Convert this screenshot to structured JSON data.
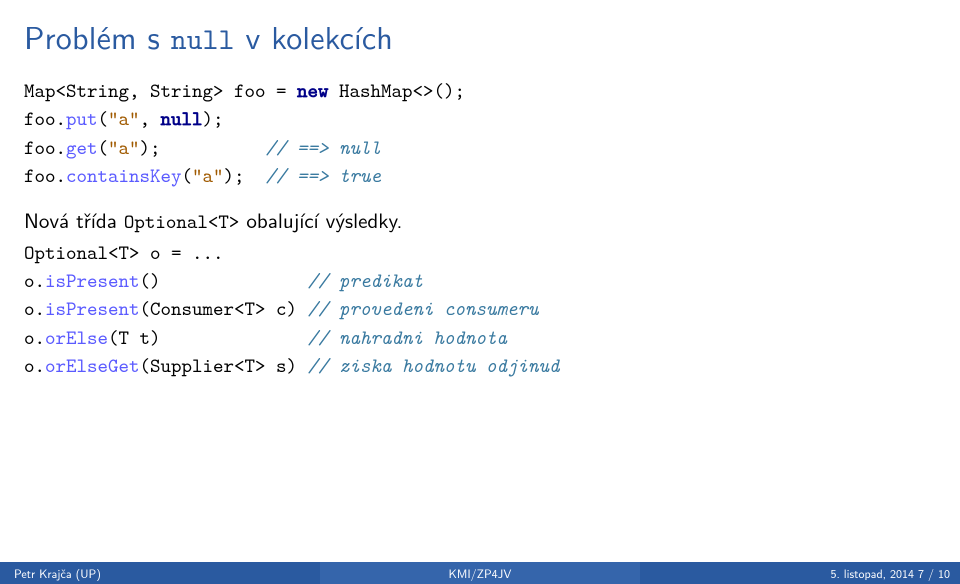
{
  "slide": {
    "title_pre": "Problém s ",
    "title_mono": "null",
    "title_post": " v kolekcích",
    "code1": {
      "l1a": "Map<String, String> foo = ",
      "l1b": "new",
      "l1c": " HashMap<>();",
      "l2a": "foo.",
      "l2b": "put",
      "l2c": "(",
      "l2d": "\"a\"",
      "l2e": ", ",
      "l2f": "null",
      "l2g": ");",
      "l3a": "foo.",
      "l3b": "get",
      "l3c": "(",
      "l3d": "\"a\"",
      "l3e": ");          ",
      "l3f": "// ==> null",
      "l4a": "foo.",
      "l4b": "containsKey",
      "l4c": "(",
      "l4d": "\"a\"",
      "l4e": ");  ",
      "l4f": "// ==> true"
    },
    "para1a": "Nová třída ",
    "para1b": "Optional<T>",
    "para1c": " obalující výsledky.",
    "code2": {
      "l1": "Optional<T> o = ...",
      "l2a": "o.",
      "l2b": "isPresent",
      "l2c": "()              ",
      "l2d": "// predikat",
      "l3a": "o.",
      "l3b": "isPresent",
      "l3c": "(Consumer<T> c) ",
      "l3d": "// provedeni consumeru",
      "l4a": "o.",
      "l4b": "orElse",
      "l4c": "(T t)              ",
      "l4d": "// nahradni hodnota",
      "l5a": "o.",
      "l5b": "orElseGet",
      "l5c": "(Supplier<T> s) ",
      "l5d": "// ziska hodnotu odjinud"
    }
  },
  "footer": {
    "left": "Petr Krajča (UP)",
    "mid": "KMI/ZP4JV",
    "right": "5. listopad, 2014     7 / 10"
  }
}
